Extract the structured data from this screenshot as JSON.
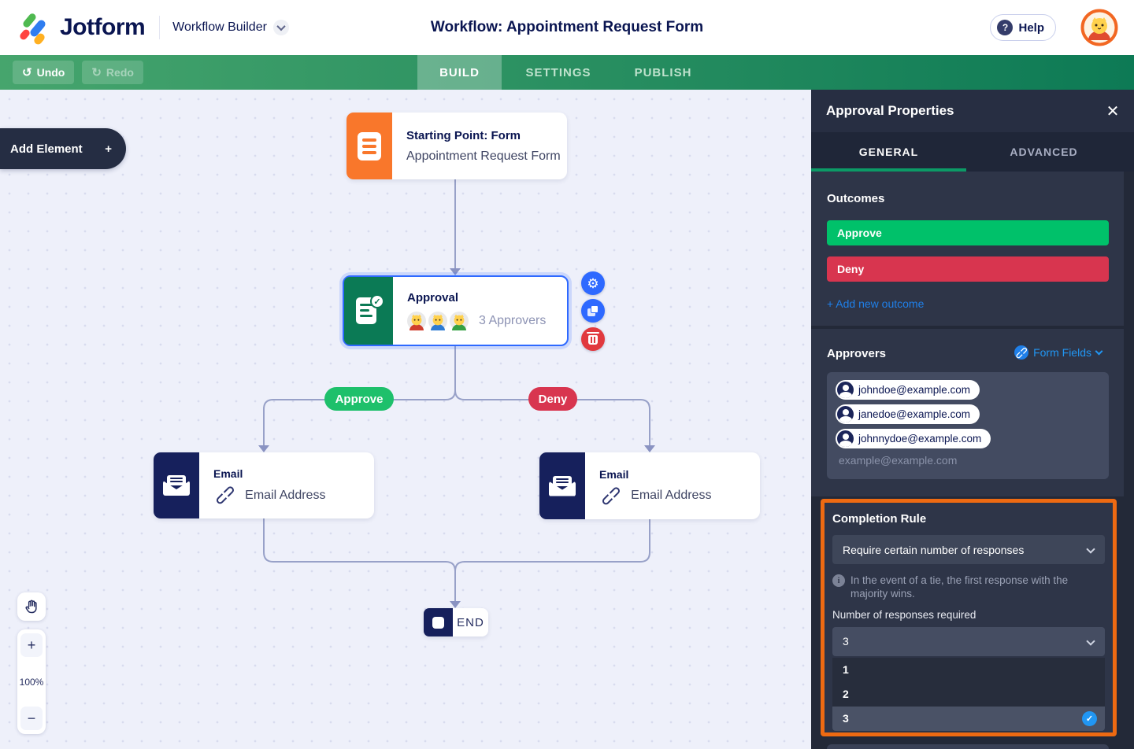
{
  "header": {
    "brand": "Jotform",
    "app_name": "Workflow Builder",
    "title": "Workflow: Appointment Request Form",
    "help_label": "Help"
  },
  "toolbar": {
    "undo_label": "Undo",
    "redo_label": "Redo",
    "undo_icon": "↺",
    "redo_icon": "↻",
    "tabs": [
      {
        "label": "BUILD",
        "active": true
      },
      {
        "label": "SETTINGS",
        "active": false
      },
      {
        "label": "PUBLISH",
        "active": false
      }
    ]
  },
  "canvas": {
    "add_element_label": "Add Element",
    "zoom_level": "100%",
    "nodes": {
      "start": {
        "title": "Starting Point: Form",
        "subtitle": "Appointment Request Form"
      },
      "approval": {
        "title": "Approval",
        "subtitle": "3 Approvers"
      },
      "email_left": {
        "title": "Email",
        "subtitle": "Email Address"
      },
      "email_right": {
        "title": "Email",
        "subtitle": "Email Address"
      },
      "end": {
        "label": "END"
      }
    },
    "branches": {
      "approve": "Approve",
      "deny": "Deny"
    }
  },
  "panel": {
    "title": "Approval Properties",
    "tabs": {
      "general": "GENERAL",
      "advanced": "ADVANCED"
    },
    "outcomes": {
      "heading": "Outcomes",
      "items": [
        {
          "label": "Approve",
          "color": "#00c16a"
        },
        {
          "label": "Deny",
          "color": "#d8354f"
        }
      ],
      "add_label": "+ Add new outcome"
    },
    "approvers": {
      "heading": "Approvers",
      "form_fields_label": "Form Fields",
      "chips": [
        "johndoe@example.com",
        "janedoe@example.com",
        "johnnydoe@example.com"
      ],
      "placeholder": "example@example.com"
    },
    "completion_rule": {
      "heading": "Completion Rule",
      "rule_value": "Require certain number of responses",
      "info_text": "In the event of a tie, the first response with the majority wins.",
      "count_label": "Number of responses required",
      "count_value": "3",
      "options": [
        "1",
        "2",
        "3"
      ],
      "selected_option": "3",
      "highlight_color": "#ee6a12"
    }
  },
  "colors": {
    "brand_navy": "#0a1551",
    "toolbar_green_left": "#46a56d",
    "toolbar_green_right": "#0d7a55",
    "approve_green": "#1ec06b",
    "deny_red": "#d8354f",
    "selection_blue": "#2e69ff",
    "panel_bg": "#232938",
    "link_blue": "#2196f3"
  }
}
